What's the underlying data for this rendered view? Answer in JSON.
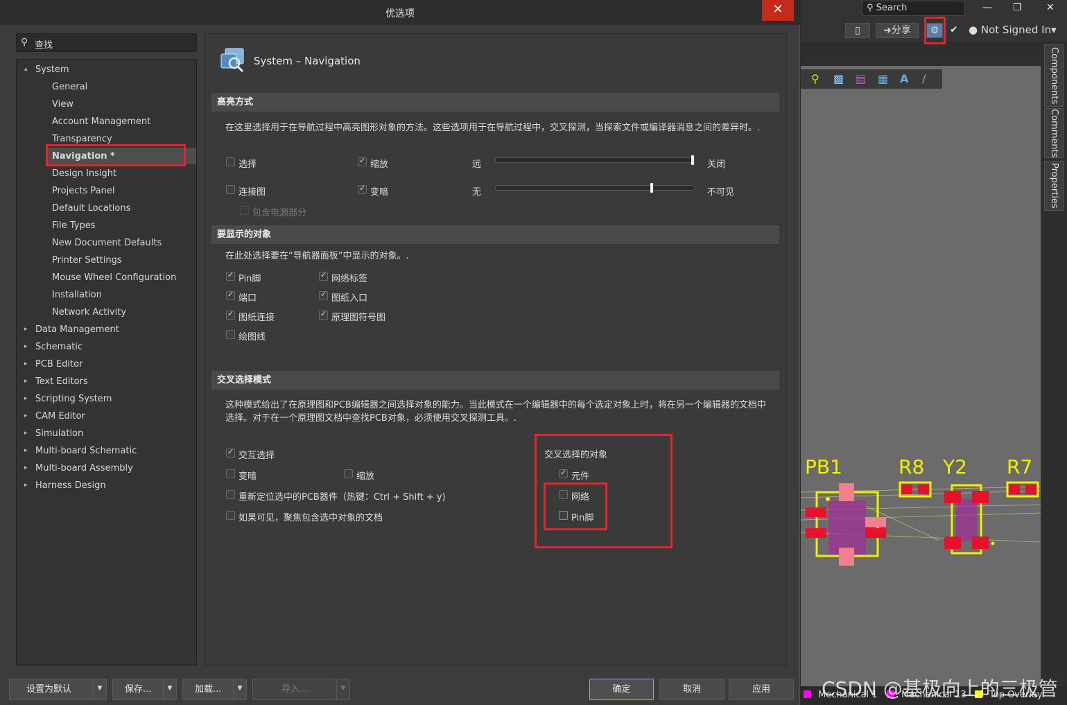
{
  "dialog": {
    "title": "优选项",
    "close_glyph": "✕",
    "search_placeholder": "查找",
    "pane_title": "System – Navigation"
  },
  "tree": {
    "system": "System",
    "children": [
      "General",
      "View",
      "Account Management",
      "Transparency",
      "Navigation *",
      "Design Insight",
      "Projects Panel",
      "Default Locations",
      "File Types",
      "New Document Defaults",
      "Printer Settings",
      "Mouse Wheel Configuration",
      "Installation",
      "Network Activity"
    ],
    "top_items": [
      "Data Management",
      "Schematic",
      "PCB Editor",
      "Text Editors",
      "Scripting System",
      "CAM Editor",
      "Simulation",
      "Multi-board Schematic",
      "Multi-board Assembly",
      "Harness Design"
    ],
    "selected": "Navigation *"
  },
  "highlight": {
    "header": "高亮方式",
    "desc": "在这里选择用于在导航过程中高亮图形对象的方法。这些选项用于在导航过程中，交叉探测，当探索文件或编译器消息之间的差异时。.",
    "select_label": "选择",
    "select_checked": false,
    "zoom_label": "缩放",
    "zoom_checked": true,
    "far_label": "远",
    "off_label": "关闭",
    "slider1_value": 1.0,
    "connection_label": "连接图",
    "connection_checked": false,
    "dim_label": "变暗",
    "dim_checked": true,
    "none_label": "无",
    "invisible_label": "不可见",
    "slider2_value": 0.79,
    "power_label": "包含电源部分",
    "power_checked": false
  },
  "objects": {
    "header": "要显示的对象",
    "desc": "在此处选择要在“导航器面板”中显示的对象。.",
    "items": [
      {
        "label": "Pin脚",
        "checked": true
      },
      {
        "label": "网络标签",
        "checked": true
      },
      {
        "label": "端口",
        "checked": true
      },
      {
        "label": "图纸入口",
        "checked": true
      },
      {
        "label": "图纸连接",
        "checked": true
      },
      {
        "label": "原理图符号图",
        "checked": true
      },
      {
        "label": "绘图线",
        "checked": false
      }
    ]
  },
  "cross": {
    "header": "交叉选择模式",
    "desc": "这种模式给出了在原理图和PCB编辑器之间选择对象的能力。当此模式在一个编辑器中的每个选定对象上时，将在另一个编辑器的文档中选择。对于在一个原理图文档中查找PCB对象，必须使用交叉探测工具。.",
    "interactive_label": "交互选择",
    "interactive_checked": true,
    "dim_label": "变暗",
    "dim_checked": false,
    "zoom_label": "缩放",
    "zoom_checked": false,
    "reposition_label": "重新定位选中的PCB器件（热键：Ctrl + Shift + y)",
    "reposition_checked": false,
    "focus_label": "如果可见，聚焦包含选中对象的文档",
    "focus_checked": false,
    "objects_title": "交叉选择的对象",
    "component_label": "元件",
    "component_checked": true,
    "net_label": "网络",
    "net_checked": false,
    "pin_label": "Pin脚",
    "pin_checked": false
  },
  "buttons": {
    "set_default": "设置为默认",
    "save": "保存...",
    "load": "加载...",
    "import": "导入...",
    "ok": "确定",
    "cancel": "取消",
    "apply": "应用"
  },
  "app": {
    "search": "Search",
    "share": "分享",
    "signin": "Not Signed In",
    "side_tabs": [
      "Components",
      "Comments",
      "Properties"
    ],
    "layers": [
      "Mechanical 1",
      "Mechanical 13",
      "Top Overlay"
    ],
    "layer_colors": [
      "#ff00ff",
      "#ff00ff",
      "#ffff00"
    ],
    "designators": [
      "PB1",
      "R8",
      "Y2",
      "R7"
    ]
  },
  "watermark": "CSDN @基极向上的三极管"
}
